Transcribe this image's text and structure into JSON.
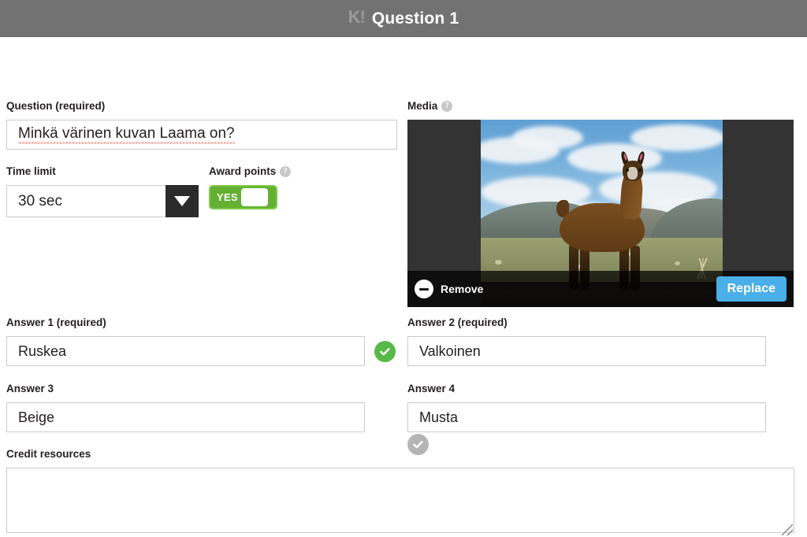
{
  "header": {
    "logo": "K!",
    "title": "Question 1"
  },
  "question": {
    "label": "Question (required)",
    "value": "Minkä värinen kuvan Laama on?",
    "placeholder": ""
  },
  "time_limit": {
    "label": "Time limit",
    "value": "30 sec",
    "dropdown_icon": "chevron-down-icon"
  },
  "award_points": {
    "label": "Award points",
    "help_icon": "help-circle-icon",
    "help_glyph": "?",
    "toggle_value": "YES"
  },
  "media": {
    "label": "Media",
    "help_icon": "help-circle-icon",
    "help_glyph": "?",
    "remove_label": "Remove",
    "remove_icon": "minus-circle-icon",
    "replace_label": "Replace",
    "image_description": "Brown llama standing on altiplano grassland with mountains and clouds"
  },
  "answers": [
    {
      "label": "Answer 1 (required)",
      "value": "Ruskea",
      "correct": true,
      "check_icon": "check-circle-icon"
    },
    {
      "label": "Answer 2 (required)",
      "value": "Valkoinen",
      "correct": false,
      "check_icon": "check-circle-icon"
    },
    {
      "label": "Answer 3",
      "value": "Beige",
      "correct": false,
      "check_icon": "check-circle-icon"
    },
    {
      "label": "Answer 4",
      "value": "Musta",
      "correct": false,
      "check_icon": "check-circle-icon"
    }
  ],
  "credit_resources": {
    "label": "Credit resources",
    "value": "",
    "placeholder": ""
  },
  "colors": {
    "header_bg": "#727272",
    "correct_green": "#57b947",
    "inactive_gray": "#b5b5b5",
    "toggle_green": "#63b032",
    "replace_blue": "#4aaee8",
    "dark_control": "#2b2b2b",
    "media_letterbox": "#333333"
  }
}
